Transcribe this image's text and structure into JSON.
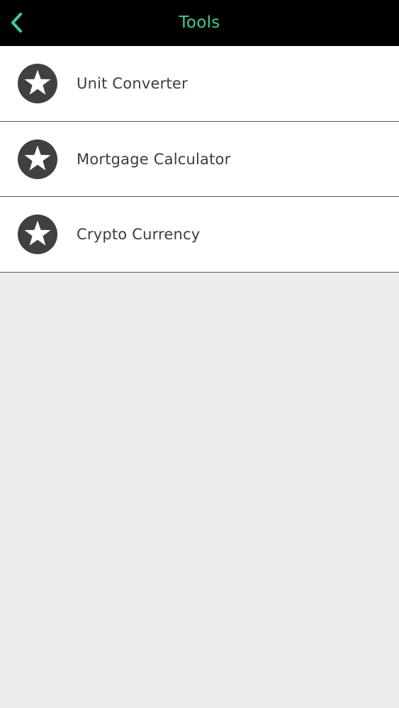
{
  "header": {
    "title": "Tools",
    "back_icon": "chevron-left-icon"
  },
  "colors": {
    "accent": "#3ecf8e",
    "navbar_bg": "#000000",
    "icon_bg": "#404040",
    "label_text": "#3d3c41",
    "page_bg": "#edebee"
  },
  "tools": {
    "items": [
      {
        "label": "Unit Converter",
        "icon": "star-icon"
      },
      {
        "label": "Mortgage Calculator",
        "icon": "star-icon"
      },
      {
        "label": "Crypto Currency",
        "icon": "star-icon"
      }
    ]
  }
}
